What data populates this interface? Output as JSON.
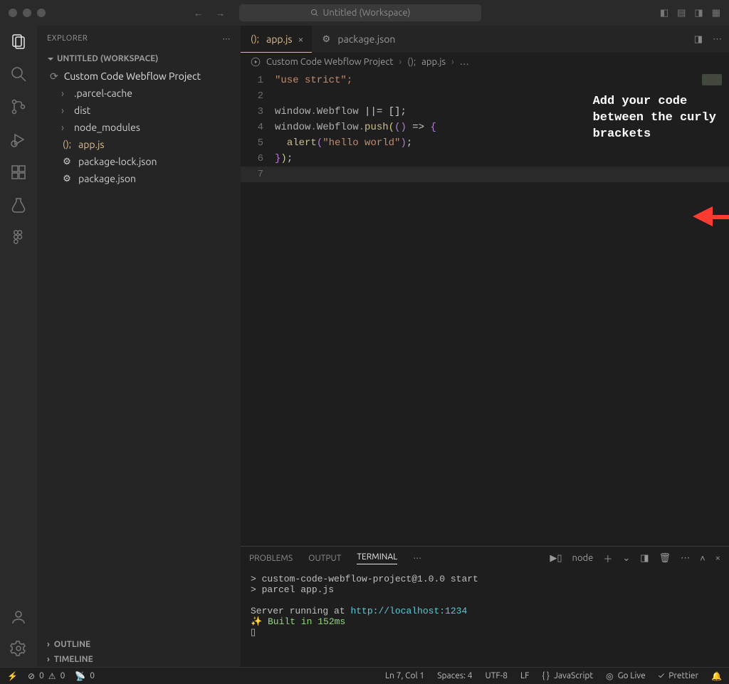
{
  "titlebar": {
    "search_placeholder": "Untitled (Workspace)"
  },
  "sidebar": {
    "header": "EXPLORER",
    "workspace": "UNTITLED (WORKSPACE)",
    "project": "Custom Code Webflow Project",
    "folders": [
      ".parcel-cache",
      "dist",
      "node_modules"
    ],
    "files": [
      {
        "name": "app.js",
        "icon": "();",
        "active": true
      },
      {
        "name": "package-lock.json",
        "icon": "⚙",
        "active": false
      },
      {
        "name": "package.json",
        "icon": "⚙",
        "active": false
      }
    ],
    "outline": "OUTLINE",
    "timeline": "TIMELINE"
  },
  "tabs": [
    {
      "icon": "();",
      "label": "app.js",
      "active": true
    },
    {
      "icon": "⚙",
      "label": "package.json",
      "active": false
    }
  ],
  "breadcrumb": {
    "project": "Custom Code Webflow Project",
    "file_icon": "();",
    "file": "app.js",
    "trail": "…"
  },
  "code": {
    "line1": "\"use strict\";",
    "line3_a": "window",
    "line3_b": ".",
    "line3_c": "Webflow",
    "line3_d": " ||= [];",
    "line4_a": "window",
    "line4_b": ".",
    "line4_c": "Webflow",
    "line4_d": ".",
    "line4_e": "push",
    "line4_f": "(",
    "line4_g": "()",
    "line4_h": " => ",
    "line4_i": "{",
    "line5_a": "  ",
    "line5_b": "alert",
    "line5_c": "(",
    "line5_d": "\"hello world\"",
    "line5_e": ")",
    "line5_f": ";",
    "line6_a": "}",
    "line6_b": ")",
    "line6_c": ";"
  },
  "callout": {
    "l1": "Add your code",
    "l2": "between the curly",
    "l3": "brackets"
  },
  "panel": {
    "tabs": [
      "PROBLEMS",
      "OUTPUT",
      "TERMINAL"
    ],
    "active_tab": "TERMINAL",
    "profile": "node",
    "terminal": {
      "line1": "> custom-code-webflow-project@1.0.0 start",
      "line2": "> parcel app.js",
      "line3_a": "Server running at ",
      "line3_b": "http://localhost:1234",
      "line4_a": "✨ ",
      "line4_b": "Built in 152ms",
      "cursor": "▯"
    }
  },
  "status": {
    "errors": "0",
    "warnings": "0",
    "ports": "0",
    "cursor": "Ln 7, Col 1",
    "spaces": "Spaces: 4",
    "encoding": "UTF-8",
    "eol": "LF",
    "lang": "JavaScript",
    "golive": "Go Live",
    "prettier": "Prettier"
  }
}
